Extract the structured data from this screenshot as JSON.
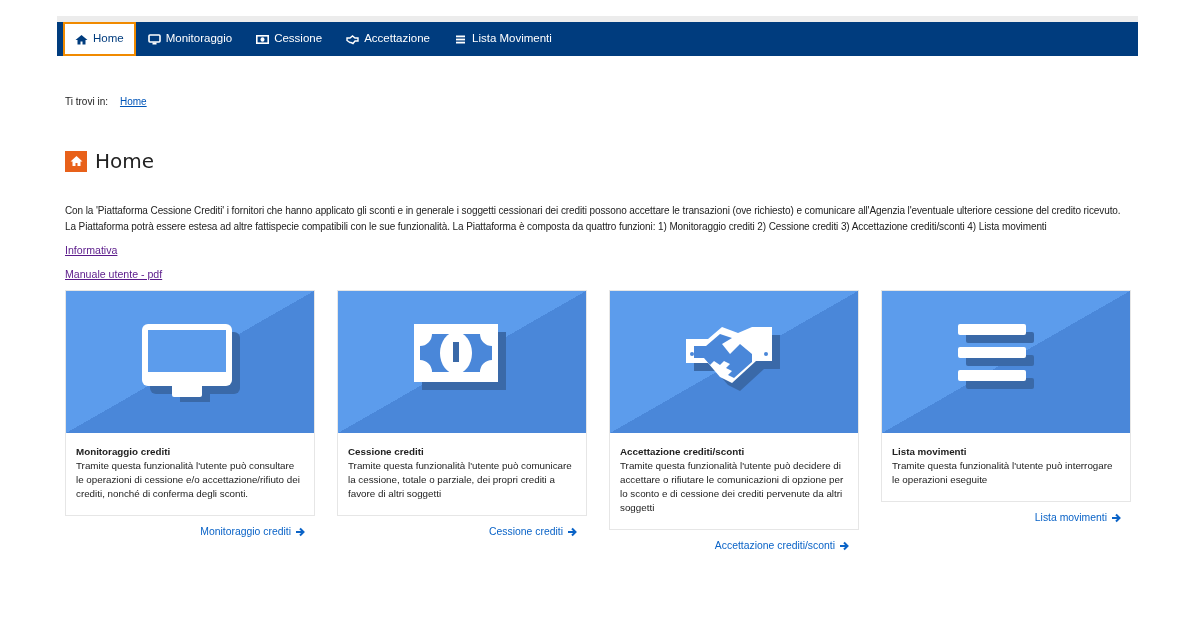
{
  "nav": [
    {
      "label": "Home",
      "kind": "home",
      "selected": true
    },
    {
      "label": "Monitoraggio",
      "kind": "monitor",
      "selected": false
    },
    {
      "label": "Cessione",
      "kind": "banknote",
      "selected": false
    },
    {
      "label": "Accettazione",
      "kind": "handshake",
      "selected": false
    },
    {
      "label": "Lista Movimenti",
      "kind": "list",
      "selected": false
    }
  ],
  "breadcrumb": {
    "label": "Ti trovi in:",
    "items": [
      "Home"
    ]
  },
  "heading": "Home",
  "intro": "Con la 'Piattaforma Cessione Crediti' i fornitori che hanno applicato gli sconti e in generale i soggetti cessionari dei crediti possono accettare le transazioni (ove richiesto) e comunicare all'Agenzia l'eventuale ulteriore cessione del credito ricevuto. La Piattaforma potrà essere estesa ad altre fattispecie compatibili con le sue funzionalità. La Piattaforma è composta da quattro funzioni: 1) Monitoraggio crediti 2) Cessione crediti 3) Accettazione crediti/sconti 4) Lista movimenti",
  "links": [
    "Informativa",
    "Manuale utente - pdf"
  ],
  "cards": [
    {
      "kind": "monitor",
      "title": "Monitoraggio crediti",
      "text": "Tramite questa funzionalità l'utente può consultare le operazioni di cessione e/o accettazione/rifiuto dei crediti, nonché di conferma degli sconti.",
      "link": "Monitoraggio crediti"
    },
    {
      "kind": "banknote",
      "title": "Cessione crediti",
      "text": "Tramite questa funzionalità l'utente può comunicare la cessione, totale o parziale, dei propri crediti a favore di altri soggetti",
      "link": "Cessione crediti"
    },
    {
      "kind": "handshake",
      "title": "Accettazione crediti/sconti",
      "text": "Tramite questa funzionalità l'utente può decidere di accettare o rifiutare le comunicazioni di opzione per lo sconto e di cessione dei crediti pervenute da altri soggetti",
      "link": "Accettazione crediti/sconti"
    },
    {
      "kind": "list",
      "title": "Lista movimenti",
      "text": "Tramite questa funzionalità l'utente può interrogare le operazioni eseguite",
      "link": "Lista movimenti"
    }
  ]
}
